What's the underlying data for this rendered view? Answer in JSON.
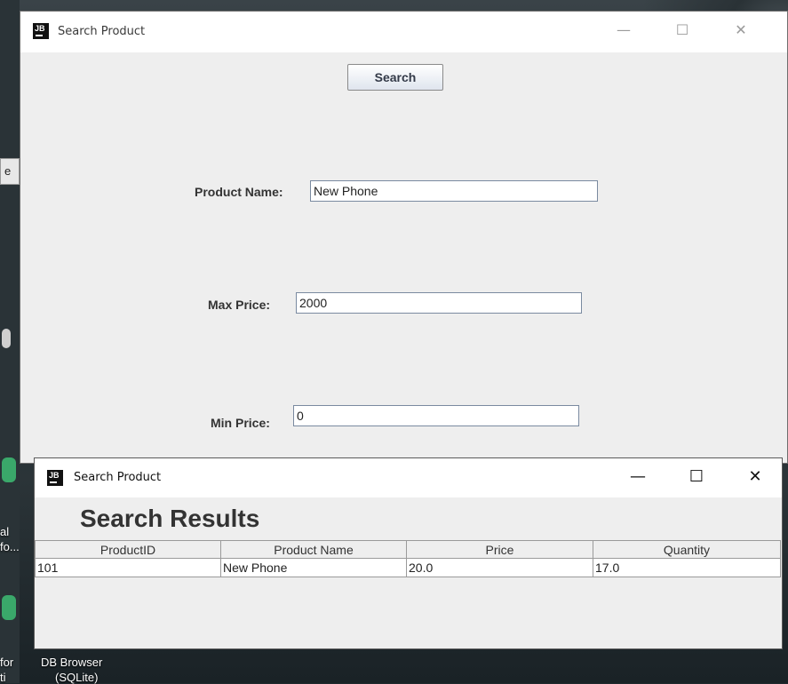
{
  "desktop": {
    "left_fragment_text": "e",
    "icon_labels": [
      "al",
      "fo...",
      "for",
      "ti"
    ],
    "db_browser_label": "DB Browser",
    "db_browser_sub": "(SQLite)"
  },
  "search_window": {
    "title": "Search Product",
    "app_icon": "JB",
    "minimize": "—",
    "maximize": "☐",
    "close": "✕",
    "search_button": "Search",
    "fields": {
      "product_name": {
        "label": "Product Name:",
        "value": "New Phone"
      },
      "max_price": {
        "label": "Max Price:",
        "value": "2000"
      },
      "min_price": {
        "label": "Min Price:",
        "value": "0"
      }
    }
  },
  "results_window": {
    "title": "Search Product",
    "app_icon": "JB",
    "minimize": "—",
    "maximize": "☐",
    "close": "✕",
    "heading": "Search Results",
    "columns": [
      "ProductID",
      "Product Name",
      "Price",
      "Quantity"
    ],
    "rows": [
      [
        "101",
        "New Phone",
        "20.0",
        "17.0"
      ]
    ]
  }
}
